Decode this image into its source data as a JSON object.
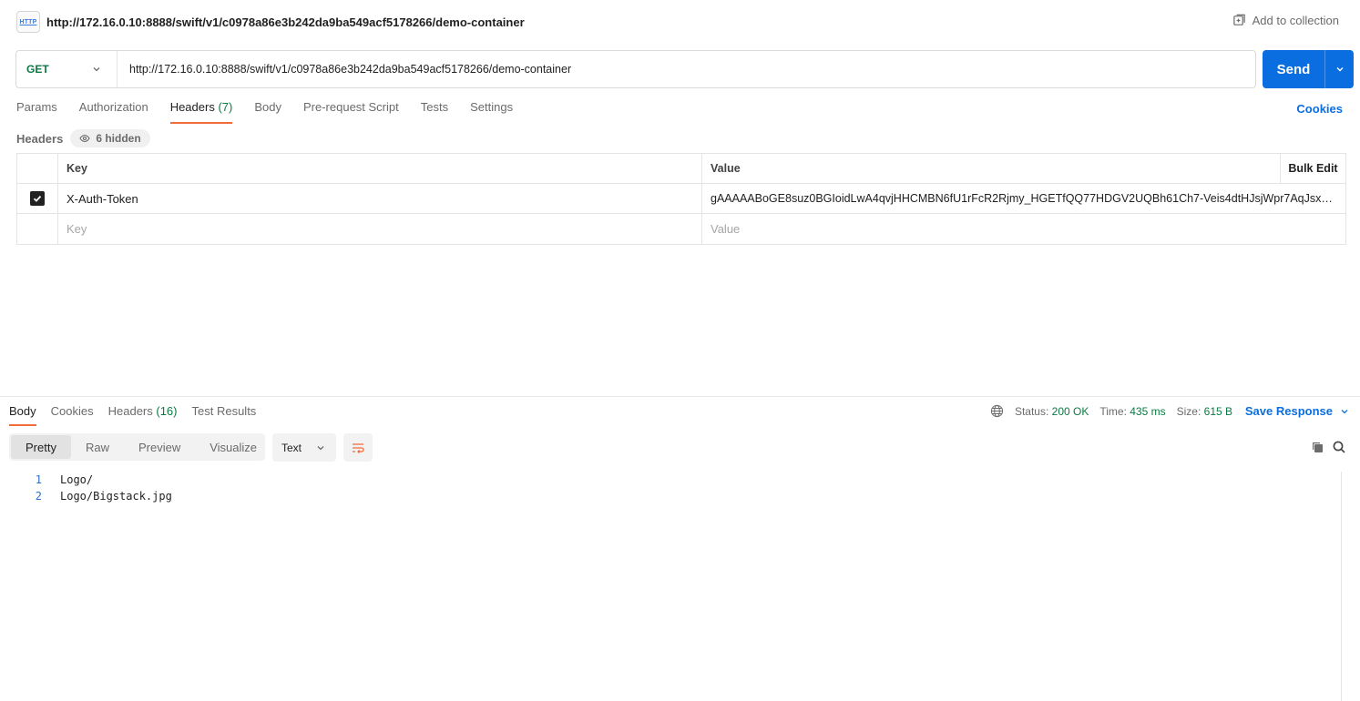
{
  "request": {
    "title": "http://172.16.0.10:8888/swift/v1/c0978a86e3b242da9ba549acf5178266/demo-container",
    "icon_label": "HTTP",
    "add_to_collection": "Add to collection",
    "method": "GET",
    "url": "http://172.16.0.10:8888/swift/v1/c0978a86e3b242da9ba549acf5178266/demo-container",
    "send_label": "Send"
  },
  "req_tabs": {
    "params": "Params",
    "authorization": "Authorization",
    "headers": "Headers",
    "headers_count": "(7)",
    "body": "Body",
    "prerequest": "Pre-request Script",
    "tests": "Tests",
    "settings": "Settings",
    "cookies": "Cookies"
  },
  "headers_section": {
    "label": "Headers",
    "hidden": "6 hidden",
    "col_key": "Key",
    "col_value": "Value",
    "bulk_edit": "Bulk Edit",
    "rows": [
      {
        "key": "X-Auth-Token",
        "value": "gAAAAABoGE8suz0BGIoidLwA4qvjHHCMBN6fU1rFcR2Rjmy_HGETfQQ77HDGV2UQBh61Ch7-Veis4dtHJsjWpr7AqJsxWn...",
        "checked": true
      }
    ],
    "placeholder_key": "Key",
    "placeholder_value": "Value"
  },
  "response": {
    "tabs": {
      "body": "Body",
      "cookies": "Cookies",
      "headers": "Headers",
      "headers_count": "(16)",
      "test_results": "Test Results"
    },
    "status_label": "Status:",
    "status_value": "200 OK",
    "time_label": "Time:",
    "time_value": "435 ms",
    "size_label": "Size:",
    "size_value": "615 B",
    "save_response": "Save Response",
    "formats": {
      "pretty": "Pretty",
      "raw": "Raw",
      "preview": "Preview",
      "visualize": "Visualize"
    },
    "text_type": "Text",
    "lines": [
      {
        "n": "1",
        "text": "Logo/"
      },
      {
        "n": "2",
        "text": "Logo/Bigstack.jpg"
      }
    ]
  },
  "colors": {
    "accent": "#0b6ee0",
    "method_green": "#0c7a43",
    "tab_underline": "#f26b3a"
  }
}
